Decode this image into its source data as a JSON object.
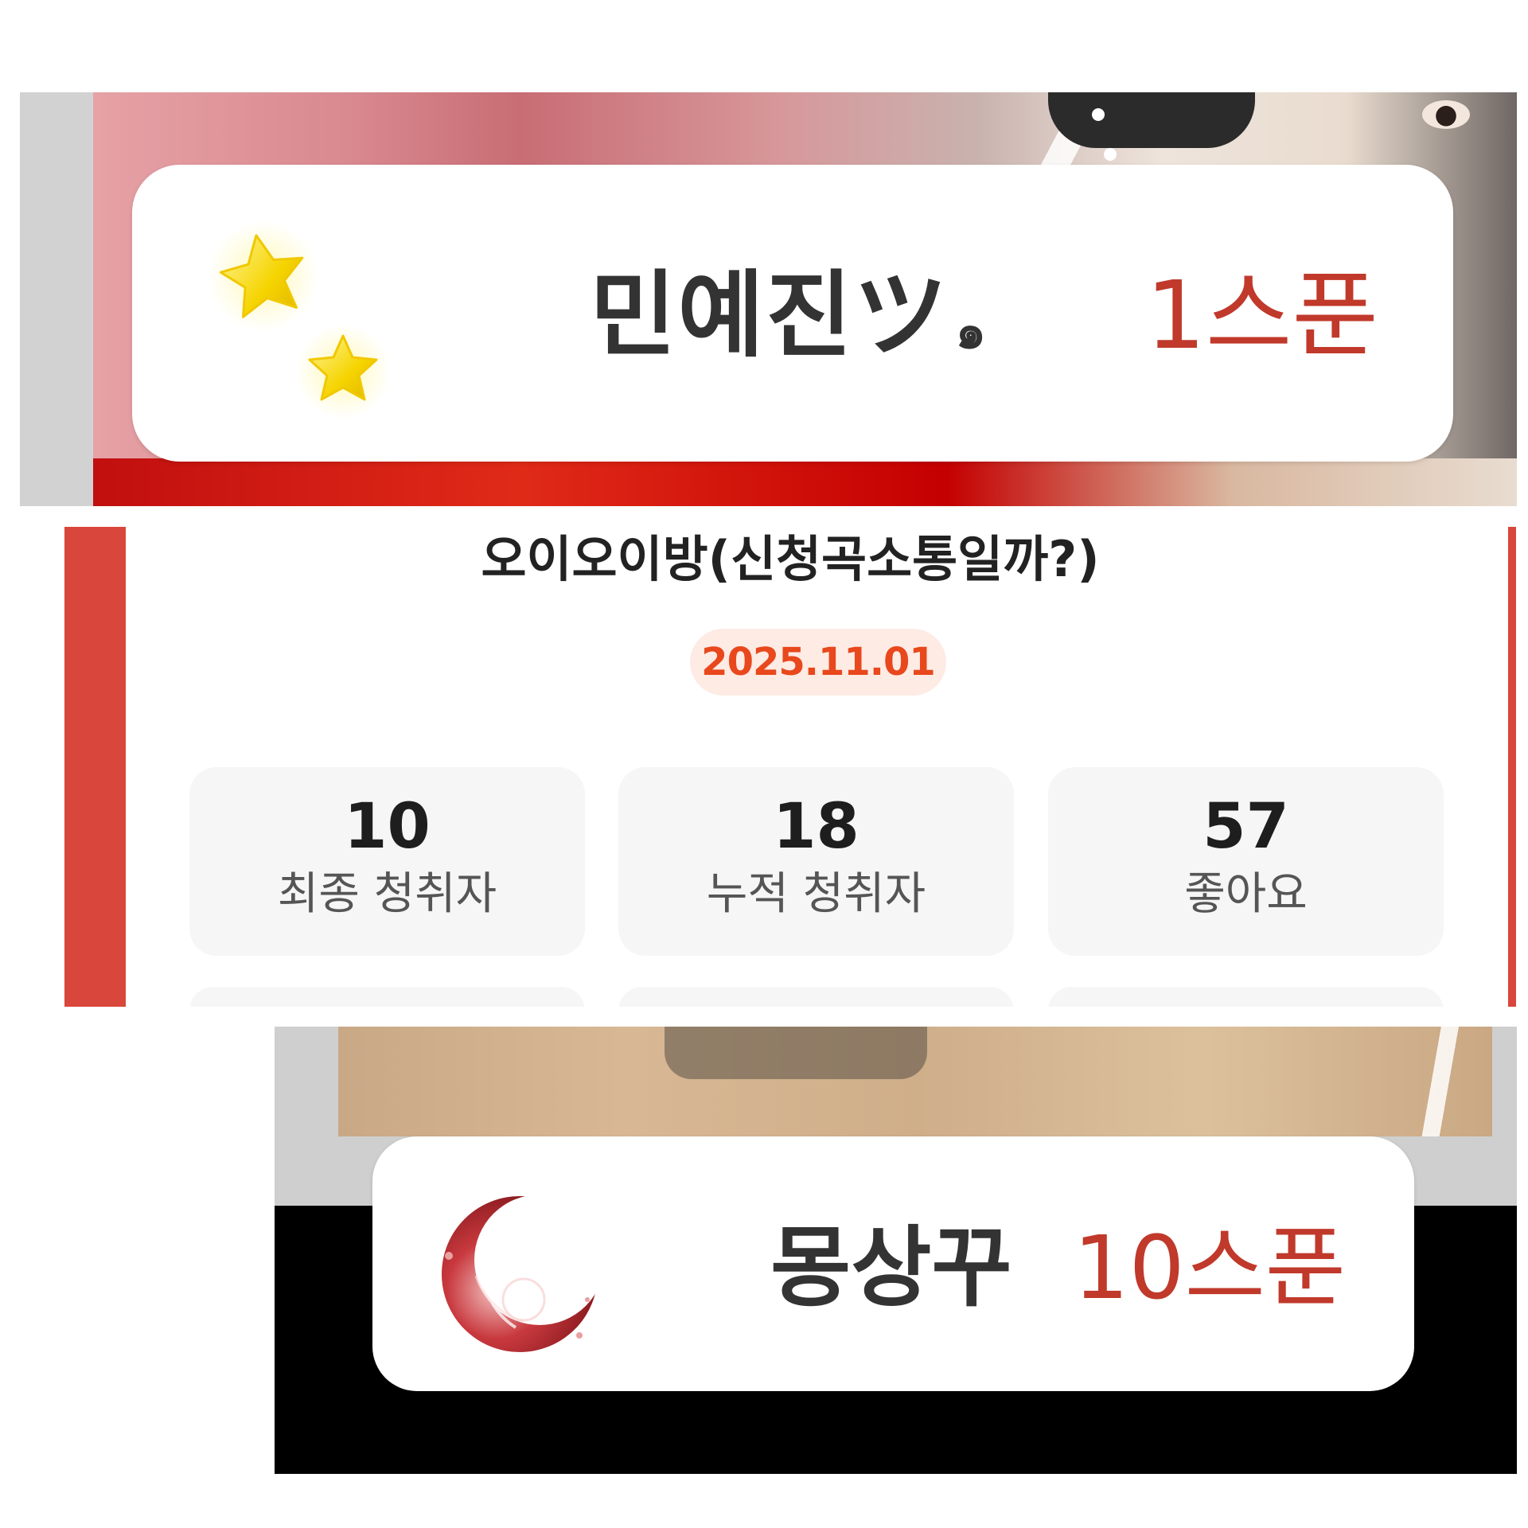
{
  "top_card": {
    "name": "민예진ツ",
    "emoji": "๑",
    "amount": "1스푼",
    "icon": "stars-icon"
  },
  "broadcast": {
    "title": "오이오이방(신청곡소통일까?)",
    "date": "2025.11.01",
    "stats": [
      {
        "value": "10",
        "label": "최종 청취자"
      },
      {
        "value": "18",
        "label": "누적 청취자"
      },
      {
        "value": "57",
        "label": "좋아요"
      }
    ]
  },
  "bottom_card": {
    "name": "몽상꾸",
    "amount": "10스푼",
    "icon": "crescent-moon-icon"
  },
  "colors": {
    "accent_red": "#d9463b",
    "amount_red": "#c0392b",
    "date_orange": "#e8481c",
    "date_bg": "#fdebe4",
    "stat_bg": "#f6f6f6"
  }
}
